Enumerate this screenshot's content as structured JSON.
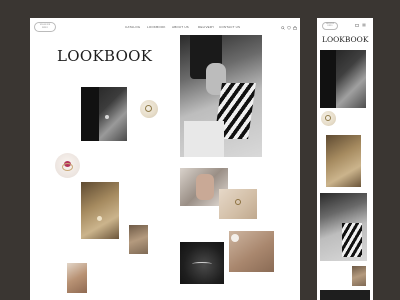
{
  "brand": {
    "logo_text": "VIOLENE\nRING"
  },
  "nav": [
    "CATALOG",
    "LOOKBOOK",
    "ABOUT US",
    "DELIVERY",
    "CONTACT US"
  ],
  "icons": [
    "search-icon",
    "heart-icon",
    "bag-icon",
    "menu-icon"
  ],
  "page": {
    "title": "LOOKBOOK"
  },
  "mobile": {
    "title": "LOOKBOOK"
  },
  "colors": {
    "background": "#3a3632",
    "page": "#ffffff",
    "text": "#1d1d1d",
    "gold": "#b79a64"
  }
}
